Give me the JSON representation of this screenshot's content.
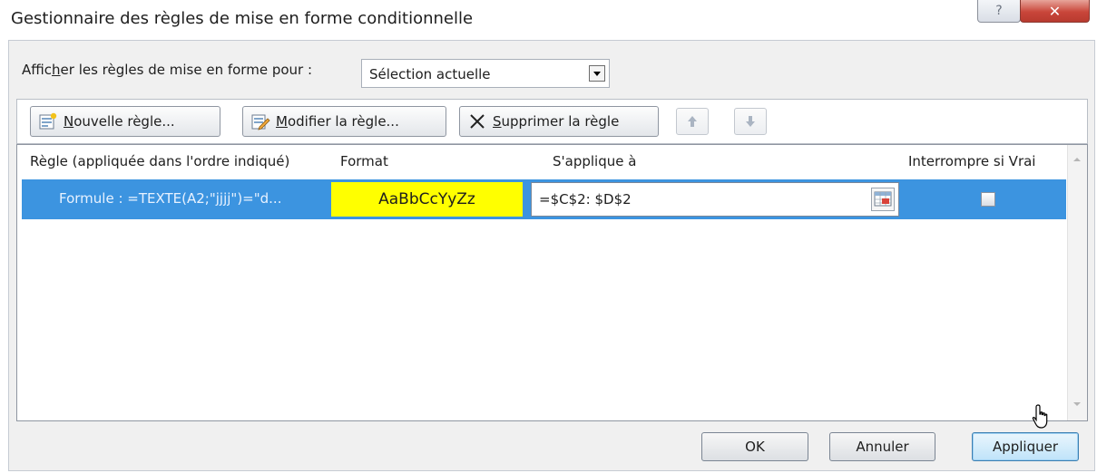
{
  "window": {
    "title": "Gestionnaire des règles de mise en forme conditionnelle",
    "help_label": "?",
    "close_label": "✕"
  },
  "show_rules": {
    "label_before": "Affic",
    "label_mnemonic": "h",
    "label_after": "er les règles de mise en forme pour :",
    "selected": "Sélection actuelle"
  },
  "toolbar": {
    "new_rule_mnemonic": "N",
    "new_rule_rest": "ouvelle règle...",
    "edit_rule_mnemonic": "M",
    "edit_rule_rest": "odifier la règle...",
    "delete_rule_mnemonic": "S",
    "delete_rule_rest": "upprimer la règle"
  },
  "columns": {
    "rule": "Règle (appliquée dans l'ordre indiqué)",
    "format": "Format",
    "applies_to": "S'applique à",
    "stop_if_true": "Interrompre si Vrai"
  },
  "rules": [
    {
      "rule": "Formule : =TEXTE(A2;\"jjjj\")=\"d...",
      "format_preview": "AaBbCcYyZz",
      "format_background": "#ffff00",
      "applies_to": "=$C$2: $D$2",
      "stop_if_true": false,
      "selected": true
    }
  ],
  "buttons": {
    "ok": "OK",
    "cancel": "Annuler",
    "apply": "Appliquer"
  },
  "colors": {
    "selection": "#3c94e0",
    "preview": "#ffff00",
    "close": "#c9463a"
  }
}
